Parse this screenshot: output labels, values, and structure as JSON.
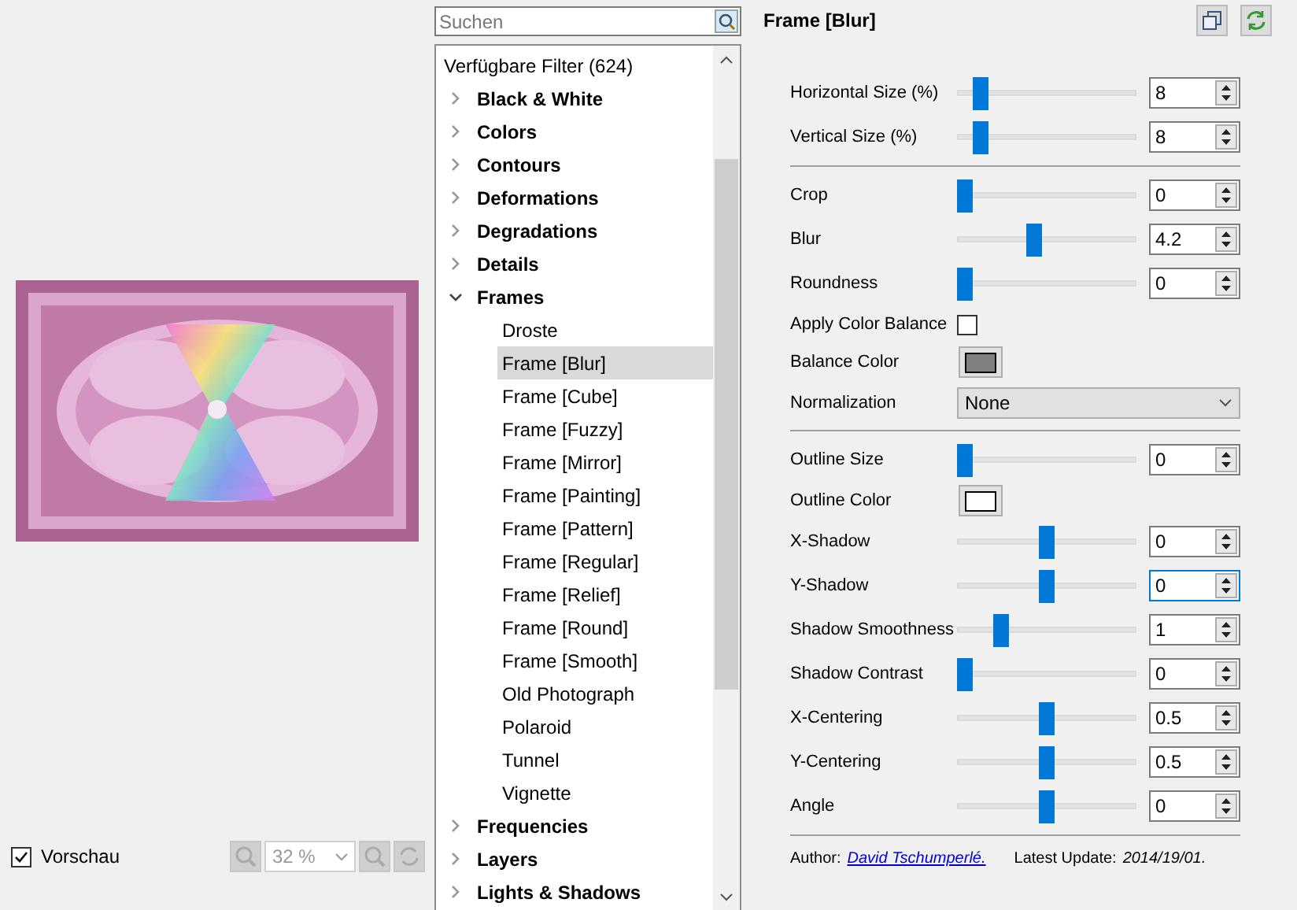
{
  "preview_checkbox": {
    "label": "Vorschau",
    "checked": true
  },
  "zoom": {
    "value": "32 %",
    "disabled": true
  },
  "search": {
    "placeholder": "Suchen"
  },
  "filter_tree": {
    "header": "Verfügbare Filter (624)",
    "items": [
      {
        "label": "Black & White",
        "expanded": false
      },
      {
        "label": "Colors",
        "expanded": false
      },
      {
        "label": "Contours",
        "expanded": false
      },
      {
        "label": "Deformations",
        "expanded": false
      },
      {
        "label": "Degradations",
        "expanded": false
      },
      {
        "label": "Details",
        "expanded": false
      },
      {
        "label": "Frames",
        "expanded": true,
        "children": [
          {
            "label": "Droste",
            "selected": false
          },
          {
            "label": "Frame [Blur]",
            "selected": true
          },
          {
            "label": "Frame [Cube]",
            "selected": false
          },
          {
            "label": "Frame [Fuzzy]",
            "selected": false
          },
          {
            "label": "Frame [Mirror]",
            "selected": false
          },
          {
            "label": "Frame [Painting]",
            "selected": false
          },
          {
            "label": "Frame [Pattern]",
            "selected": false
          },
          {
            "label": "Frame [Regular]",
            "selected": false
          },
          {
            "label": "Frame [Relief]",
            "selected": false
          },
          {
            "label": "Frame [Round]",
            "selected": false
          },
          {
            "label": "Frame [Smooth]",
            "selected": false
          },
          {
            "label": "Old Photograph",
            "selected": false
          },
          {
            "label": "Polaroid",
            "selected": false
          },
          {
            "label": "Tunnel",
            "selected": false
          },
          {
            "label": "Vignette",
            "selected": false
          }
        ]
      },
      {
        "label": "Frequencies",
        "expanded": false
      },
      {
        "label": "Layers",
        "expanded": false
      },
      {
        "label": "Lights & Shadows",
        "expanded": false
      }
    ]
  },
  "filter": {
    "title": "Frame [Blur]",
    "params": [
      {
        "kind": "slider",
        "label": "Horizontal Size (%)",
        "level": 0.1,
        "value": "8",
        "focused": false
      },
      {
        "kind": "slider",
        "label": "Vertical Size (%)",
        "level": 0.1,
        "value": "8",
        "focused": false
      },
      {
        "kind": "separator"
      },
      {
        "kind": "slider",
        "label": "Crop",
        "level": 0,
        "value": "0",
        "focused": false
      },
      {
        "kind": "slider",
        "label": "Blur",
        "level": 0.42,
        "value": "4.2",
        "focused": false
      },
      {
        "kind": "slider",
        "label": "Roundness",
        "level": 0,
        "value": "0",
        "focused": false
      },
      {
        "kind": "checkbox",
        "label": "Apply Color Balance",
        "checked": false
      },
      {
        "kind": "color",
        "label": "Balance Color",
        "color": "#808080"
      },
      {
        "kind": "select",
        "label": "Normalization",
        "value": "None"
      },
      {
        "kind": "separator"
      },
      {
        "kind": "slider",
        "label": "Outline Size",
        "level": 0,
        "value": "0",
        "focused": false
      },
      {
        "kind": "color",
        "label": "Outline Color",
        "color": "#ffffff"
      },
      {
        "kind": "slider",
        "label": "X-Shadow",
        "level": 0.5,
        "value": "0",
        "focused": false
      },
      {
        "kind": "slider",
        "label": "Y-Shadow",
        "level": 0.5,
        "value": "0",
        "focused": true
      },
      {
        "kind": "slider",
        "label": "Shadow Smoothness",
        "level": 0.22,
        "value": "1",
        "focused": false
      },
      {
        "kind": "slider",
        "label": "Shadow Contrast",
        "level": 0,
        "value": "0",
        "focused": false
      },
      {
        "kind": "slider",
        "label": "X-Centering",
        "level": 0.5,
        "value": "0.5",
        "focused": false
      },
      {
        "kind": "slider",
        "label": "Y-Centering",
        "level": 0.5,
        "value": "0.5",
        "focused": false
      },
      {
        "kind": "slider",
        "label": "Angle",
        "level": 0.5,
        "value": "0",
        "focused": false
      },
      {
        "kind": "separator"
      }
    ],
    "author_label": "Author:",
    "author": "David Tschumperlé.",
    "update_label": "Latest Update:",
    "update": "2014/19/01."
  }
}
